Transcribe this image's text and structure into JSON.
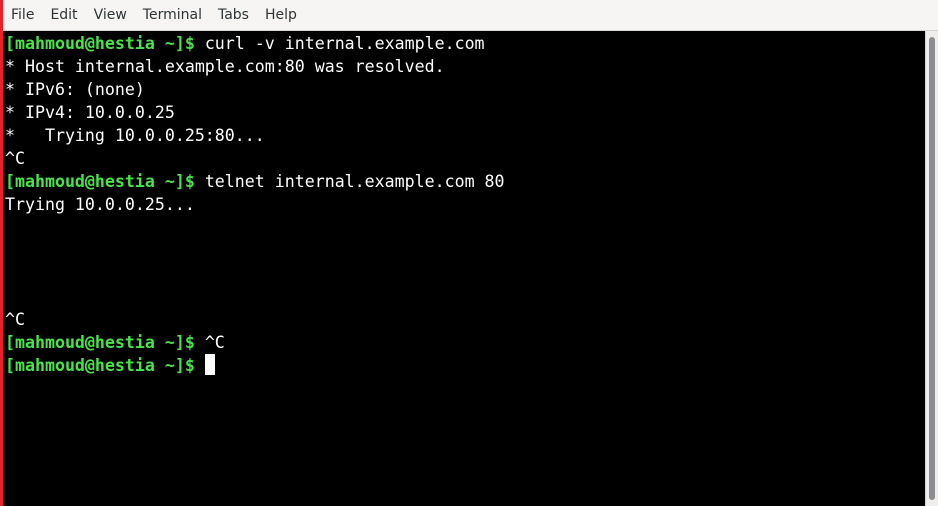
{
  "menu": {
    "file": "File",
    "edit": "Edit",
    "view": "View",
    "terminal": "Terminal",
    "tabs": "Tabs",
    "help": "Help"
  },
  "terminal": {
    "prompt": "[mahmoud@hestia ~]$",
    "lines": [
      {
        "prompt": "[mahmoud@hestia ~]$",
        "text": " curl -v internal.example.com"
      },
      {
        "prompt": "",
        "text": "* Host internal.example.com:80 was resolved."
      },
      {
        "prompt": "",
        "text": "* IPv6: (none)"
      },
      {
        "prompt": "",
        "text": "* IPv4: 10.0.0.25"
      },
      {
        "prompt": "",
        "text": "*   Trying 10.0.0.25:80..."
      },
      {
        "prompt": "",
        "text": "^C"
      },
      {
        "prompt": "[mahmoud@hestia ~]$",
        "text": " telnet internal.example.com 80"
      },
      {
        "prompt": "",
        "text": "Trying 10.0.0.25..."
      },
      {
        "prompt": "",
        "text": ""
      },
      {
        "prompt": "",
        "text": ""
      },
      {
        "prompt": "",
        "text": ""
      },
      {
        "prompt": "",
        "text": ""
      },
      {
        "prompt": "",
        "text": ""
      },
      {
        "prompt": "",
        "text": "^C"
      },
      {
        "prompt": "[mahmoud@hestia ~]$",
        "text": " ^C"
      },
      {
        "prompt": "[mahmoud@hestia ~]$",
        "text": " "
      }
    ]
  },
  "colors": {
    "prompt": "#4ae34a",
    "background": "#000000",
    "foreground": "#ffffff",
    "window_border": "#e8202a"
  }
}
